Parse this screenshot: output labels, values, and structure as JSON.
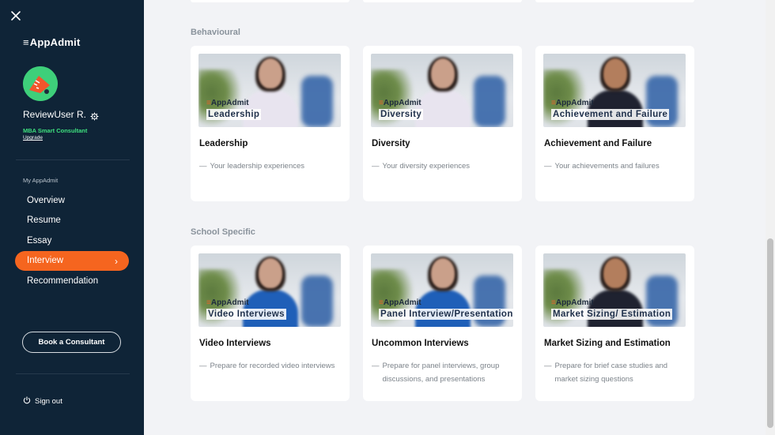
{
  "sidebar": {
    "logo_mark": "≡",
    "logo_text": "AppAdmit",
    "username": "ReviewUser R.",
    "plan": "MBA Smart Consultant",
    "upgrade": "Upgrade",
    "section_label": "My AppAdmit",
    "nav": [
      {
        "label": "Overview"
      },
      {
        "label": "Resume"
      },
      {
        "label": "Essay"
      },
      {
        "label": "Interview"
      },
      {
        "label": "Recommendation"
      }
    ],
    "active_index": 3,
    "book_label": "Book a Consultant",
    "signout_label": "Sign out"
  },
  "sections": [
    {
      "title": "Behavioural",
      "cards": [
        {
          "overlay": "Leadership",
          "title": "Leadership",
          "desc": [
            "Your leadership experiences"
          ],
          "person_color": "#e8e4ef",
          "skin": "#caa08a"
        },
        {
          "overlay": "Diversity",
          "title": "Diversity",
          "desc": [
            "Your diversity experiences"
          ],
          "person_color": "#e8e4ef",
          "skin": "#caa08a"
        },
        {
          "overlay": "Achievement and Failure",
          "title": "Achievement and Failure",
          "desc": [
            "Your achievements and failures"
          ],
          "person_color": "#1f2230",
          "skin": "#b37e5d"
        }
      ]
    },
    {
      "title": "School Specific",
      "cards": [
        {
          "overlay": "Video Interviews",
          "title": "Video Interviews",
          "desc": [
            "Prepare for recorded video interviews"
          ],
          "person_color": "#1f5fb8",
          "skin": "#caa08a"
        },
        {
          "overlay": "Panel Interview/Presentation",
          "title": "Uncommon Interviews",
          "desc": [
            "Prepare for panel interviews, group",
            "discussions, and presentations"
          ],
          "person_color": "#1f5fb8",
          "skin": "#caa08a"
        },
        {
          "overlay": "Market Sizing/ Estimation",
          "title": "Market Sizing and Estimation",
          "desc": [
            "Prepare for brief case studies and",
            "market sizing questions"
          ],
          "person_color": "#1f2230",
          "skin": "#b37e5d"
        }
      ]
    }
  ],
  "thumb_brand": "AppAdmit",
  "colors": {
    "sidebar_bg": "#0f2437",
    "accent": "#f5651f",
    "plan_green": "#3ee07e",
    "page_bg": "#f2f3f6"
  },
  "icons": [
    "close-icon",
    "gear-icon",
    "chevron-right-icon",
    "power-icon",
    "avatar-megaphone-icon"
  ]
}
